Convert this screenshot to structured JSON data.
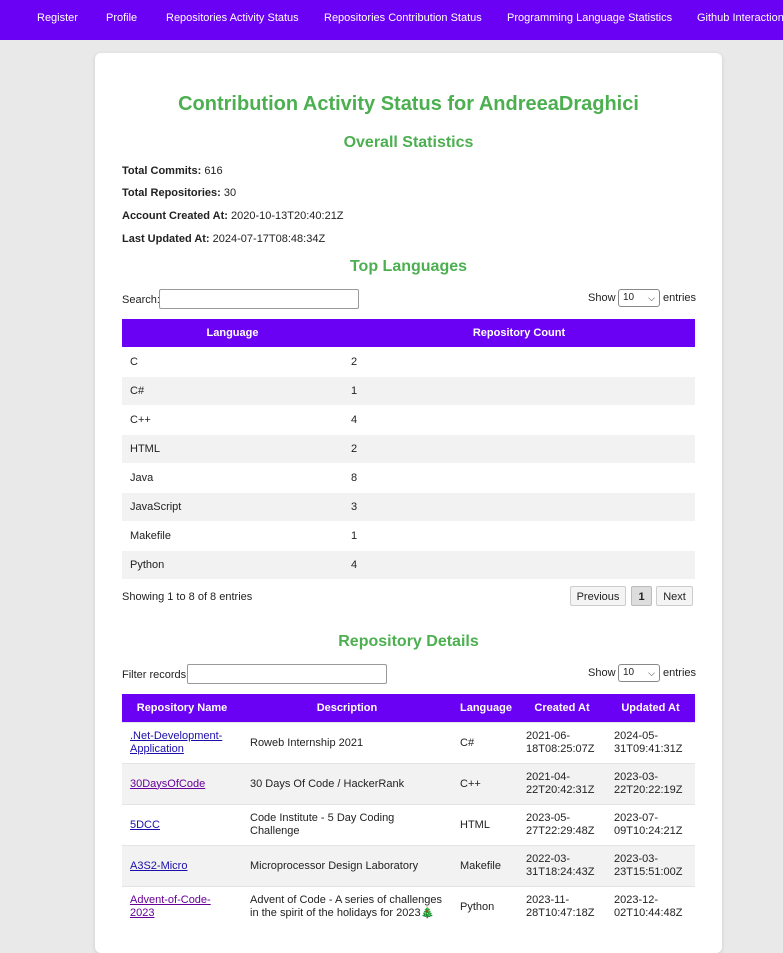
{
  "nav": {
    "items": [
      "Register",
      "Profile",
      "Repositories Activity Status",
      "Repositories Contribution Status",
      "Programming Language Statistics",
      "Github Interaction"
    ]
  },
  "page_title": "Contribution Activity Status for AndreeaDraghici",
  "overall": {
    "heading": "Overall Statistics",
    "total_commits_label": "Total Commits:",
    "total_commits": "616",
    "total_repos_label": "Total Repositories:",
    "total_repos": "30",
    "created_label": "Account Created At:",
    "created": "2020-10-13T20:40:21Z",
    "updated_label": "Last Updated At:",
    "updated": "2024-07-17T08:48:34Z"
  },
  "languages": {
    "heading": "Top Languages",
    "search_label": "Search:",
    "search_value": "",
    "show_label": "Show",
    "page_size": "10",
    "entries_label": "entries",
    "columns": [
      "Language",
      "Repository Count"
    ],
    "rows": [
      [
        "C",
        "2"
      ],
      [
        "C#",
        "1"
      ],
      [
        "C++",
        "4"
      ],
      [
        "HTML",
        "2"
      ],
      [
        "Java",
        "8"
      ],
      [
        "JavaScript",
        "3"
      ],
      [
        "Makefile",
        "1"
      ],
      [
        "Python",
        "4"
      ]
    ],
    "info": "Showing 1 to 8 of 8 entries",
    "prev_label": "Previous",
    "page_label": "1",
    "next_label": "Next"
  },
  "repos": {
    "heading": "Repository Details",
    "filter_label": "Filter records:",
    "filter_value": "",
    "show_label": "Show",
    "page_size": "10",
    "entries_label": "entries",
    "columns": [
      "Repository Name",
      "Description",
      "Language",
      "Created At",
      "Updated At"
    ],
    "rows": [
      [
        ".Net-Development-Application",
        "Roweb Internship 2021",
        "C#",
        "2021-06-18T08:25:07Z",
        "2024-05-31T09:41:31Z"
      ],
      [
        "30DaysOfCode",
        "30 Days Of Code / HackerRank",
        "C++",
        "2021-04-22T20:42:31Z",
        "2023-03-22T20:22:19Z"
      ],
      [
        "5DCC",
        "Code Institute - 5 Day Coding Challenge",
        "HTML",
        "2023-05-27T22:29:48Z",
        "2023-07-09T10:24:21Z"
      ],
      [
        "A3S2-Micro",
        "Microprocessor Design Laboratory",
        "Makefile",
        "2022-03-31T18:24:43Z",
        "2023-03-23T15:51:00Z"
      ],
      [
        "Advent-of-Code-2023",
        "Advent of Code - A series of challenges in the spirit of the holidays for 2023",
        "Python",
        "2023-11-28T10:47:18Z",
        "2023-12-02T10:44:48Z"
      ]
    ]
  },
  "icons": {
    "tree": "christmas-tree-icon",
    "chevron": "chevron-down-icon"
  },
  "colors": {
    "accent": "#6a00f4",
    "heading": "#4caf50"
  }
}
